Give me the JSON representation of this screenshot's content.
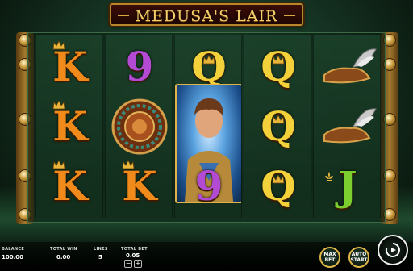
{
  "game": {
    "title": "MEDUSA'S LAIR"
  },
  "reels": [
    {
      "symbols": [
        "K",
        "K",
        "K"
      ]
    },
    {
      "symbols": [
        "9",
        "medallion",
        "K"
      ]
    },
    {
      "symbols": [
        "Q",
        "hero",
        "9"
      ]
    },
    {
      "symbols": [
        "Q",
        "Q",
        "Q"
      ]
    },
    {
      "symbols": [
        "winged-sandal",
        "winged-sandal",
        "J"
      ]
    }
  ],
  "hud": {
    "balance_label": "BALANCE",
    "balance_value": "100.00",
    "total_win_label": "TOTAL WIN",
    "total_win_value": "0.00",
    "lines_label": "LINES",
    "lines_value": "5",
    "total_bet_label": "TOTAL BET",
    "total_bet_value": "0.05",
    "max_bet_label": "MAX BET",
    "auto_start_label": "AUTO START"
  },
  "colors": {
    "gold": "#e1b74a",
    "k_orange": "#f08a1a",
    "q_yellow": "#f2d13a",
    "nine_purple": "#b24ad4",
    "j_green": "#7ccf2e"
  }
}
